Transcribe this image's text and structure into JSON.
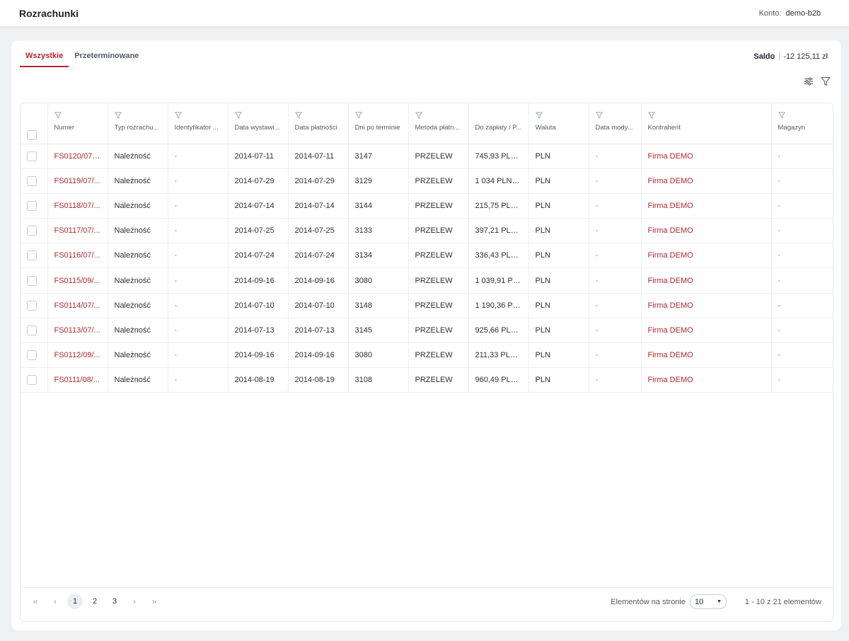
{
  "header": {
    "title": "Rozrachunki",
    "account_label": "Konto:",
    "account_value": "demo-b2b"
  },
  "tabs": [
    {
      "label": "Wszystkie",
      "active": true
    },
    {
      "label": "Przeterminowane",
      "active": false
    }
  ],
  "saldo": {
    "label": "Saldo",
    "value": "-12 125,11 zł"
  },
  "toolbar": {
    "settings_icon": "sliders-icon",
    "filter_icon": "filter-icon"
  },
  "colors": {
    "accent": "#b3282d",
    "text": "#2b2f36",
    "muted": "#555b64",
    "background": "#eff0f2"
  },
  "table": {
    "columns": [
      {
        "label": "Numer",
        "filter": true
      },
      {
        "label": "Typ rozrachu...",
        "filter": true
      },
      {
        "label": "Identyfikator ...",
        "filter": true
      },
      {
        "label": "Data wystawi...",
        "filter": true
      },
      {
        "label": "Data płatności",
        "filter": true
      },
      {
        "label": "Dni po terminie",
        "filter": true
      },
      {
        "label": "Metoda płatn...",
        "filter": true
      },
      {
        "label": "Do zapłaty / P...",
        "filter": false
      },
      {
        "label": "Waluta",
        "filter": true
      },
      {
        "label": "Data mody...",
        "filter": true
      },
      {
        "label": "Kontrahent",
        "filter": true
      },
      {
        "label": "Magazyn",
        "filter": true
      }
    ],
    "rows": [
      [
        "FS0120/07/...",
        "Należność",
        "-",
        "2014-07-11",
        "2014-07-11",
        "3147",
        "PRZELEW",
        "745,93 PLN...",
        "PLN",
        "-",
        "Firma DEMO",
        "-"
      ],
      [
        "FS0119/07/...",
        "Należność",
        "-",
        "2014-07-29",
        "2014-07-29",
        "3129",
        "PRZELEW",
        "1 034 PLN /...",
        "PLN",
        "-",
        "Firma DEMO",
        "-"
      ],
      [
        "FS0118/07/...",
        "Należność",
        "-",
        "2014-07-14",
        "2014-07-14",
        "3144",
        "PRZELEW",
        "215,75 PLN ...",
        "PLN",
        "-",
        "Firma DEMO",
        "-"
      ],
      [
        "FS0117/07/...",
        "Należność",
        "-",
        "2014-07-25",
        "2014-07-25",
        "3133",
        "PRZELEW",
        "397,21 PLN ...",
        "PLN",
        "-",
        "Firma DEMO",
        "-"
      ],
      [
        "FS0116/07/...",
        "Należność",
        "-",
        "2014-07-24",
        "2014-07-24",
        "3134",
        "PRZELEW",
        "336,43 PLN...",
        "PLN",
        "-",
        "Firma DEMO",
        "-"
      ],
      [
        "FS0115/09/...",
        "Należność",
        "-",
        "2014-09-16",
        "2014-09-16",
        "3080",
        "PRZELEW",
        "1 039,91 PL...",
        "PLN",
        "-",
        "Firma DEMO",
        "-"
      ],
      [
        "FS0114/07/...",
        "Należność",
        "-",
        "2014-07-10",
        "2014-07-10",
        "3148",
        "PRZELEW",
        "1 190,36 PL...",
        "PLN",
        "-",
        "Firma DEMO",
        "-"
      ],
      [
        "FS0113/07/...",
        "Należność",
        "-",
        "2014-07-13",
        "2014-07-13",
        "3145",
        "PRZELEW",
        "925,66 PLN...",
        "PLN",
        "-",
        "Firma DEMO",
        "-"
      ],
      [
        "FS0112/09/...",
        "Należność",
        "-",
        "2014-09-16",
        "2014-09-16",
        "3080",
        "PRZELEW",
        "211,33 PLN ...",
        "PLN",
        "-",
        "Firma DEMO",
        "-"
      ],
      [
        "FS0111/08/...",
        "Należność",
        "-",
        "2014-08-19",
        "2014-08-19",
        "3108",
        "PRZELEW",
        "960,49 PLN...",
        "PLN",
        "-",
        "Firma DEMO",
        "-"
      ]
    ]
  },
  "pagination": {
    "pages": [
      "1",
      "2",
      "3"
    ],
    "current_page": "1",
    "per_page_label": "Elementów na stronie",
    "per_page_value": "10",
    "range_text": "1 - 10 z 21 elementów"
  }
}
